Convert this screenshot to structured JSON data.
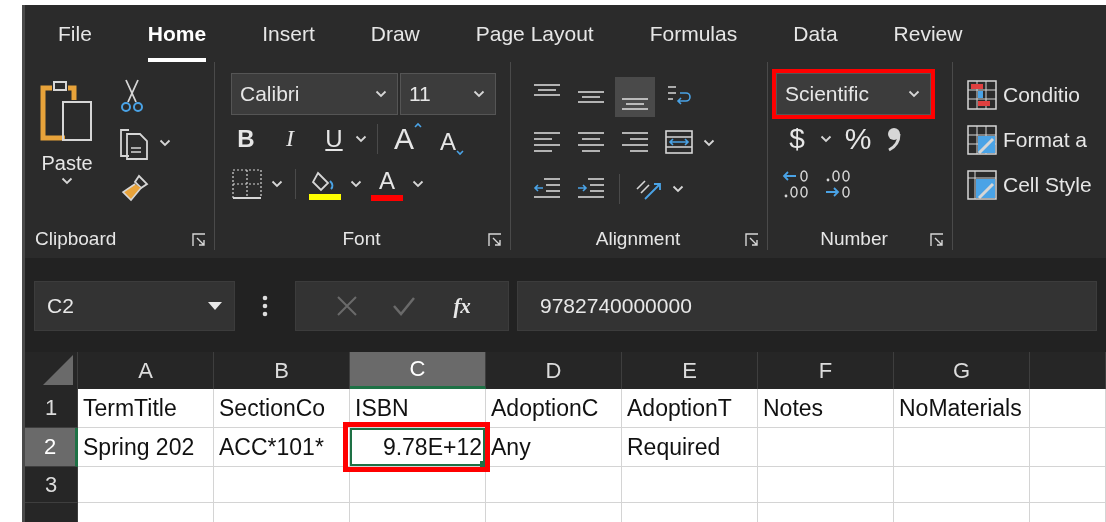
{
  "tabs": [
    {
      "label": "File",
      "selected": false
    },
    {
      "label": "Home",
      "selected": true
    },
    {
      "label": "Insert",
      "selected": false
    },
    {
      "label": "Draw",
      "selected": false
    },
    {
      "label": "Page Layout",
      "selected": false
    },
    {
      "label": "Formulas",
      "selected": false
    },
    {
      "label": "Data",
      "selected": false
    },
    {
      "label": "Review",
      "selected": false
    }
  ],
  "clipboard": {
    "paste_label": "Paste",
    "group_label": "Clipboard"
  },
  "font": {
    "name": "Calibri",
    "size": "11",
    "bold_label": "B",
    "italic_label": "I",
    "underline_label": "U",
    "grow_label": "A",
    "shrink_label": "A",
    "font_color_label": "A",
    "group_label": "Font"
  },
  "alignment": {
    "buttons": [
      {
        "kind": "top",
        "selected": false
      },
      {
        "kind": "middle",
        "selected": false
      },
      {
        "kind": "bottom",
        "selected": true
      },
      {
        "kind": "wrap",
        "selected": false
      },
      {
        "kind": "left",
        "selected": false
      },
      {
        "kind": "center",
        "selected": false
      },
      {
        "kind": "right",
        "selected": false
      },
      {
        "kind": "merge",
        "selected": false
      },
      {
        "kind": "outdent",
        "selected": false
      },
      {
        "kind": "indent",
        "selected": false
      },
      {
        "kind": "orientation",
        "selected": false
      }
    ],
    "group_label": "Alignment"
  },
  "number": {
    "format": "Scientific",
    "highlighted": true,
    "currency_label": "$",
    "percent_label": "%",
    "group_label": "Number"
  },
  "styles": {
    "items": [
      {
        "kind": "conditional",
        "label": "Conditio"
      },
      {
        "kind": "table",
        "label": "Format a"
      },
      {
        "kind": "cell",
        "label": "Cell Style"
      }
    ]
  },
  "formula_bar": {
    "name_box": "C2",
    "edit_buttons": [
      {
        "kind": "cancel",
        "disabled": true
      },
      {
        "kind": "enter",
        "disabled": true
      }
    ],
    "function_label": "fx",
    "formula": "9782740000000"
  },
  "sheet": {
    "columns": [
      {
        "label": "A",
        "selected": false
      },
      {
        "label": "B",
        "selected": false
      },
      {
        "label": "C",
        "selected": true
      },
      {
        "label": "D",
        "selected": false
      },
      {
        "label": "E",
        "selected": false
      },
      {
        "label": "F",
        "selected": false
      },
      {
        "label": "G",
        "selected": false
      }
    ],
    "rows": [
      {
        "header": "1",
        "selected": false,
        "cells": [
          {
            "text": "TermTitle"
          },
          {
            "text": "SectionCo"
          },
          {
            "text": "ISBN"
          },
          {
            "text": "AdoptionC"
          },
          {
            "text": "AdoptionT"
          },
          {
            "text": "Notes"
          },
          {
            "text": "NoMaterials"
          }
        ]
      },
      {
        "header": "2",
        "selected": true,
        "cells": [
          {
            "text": "Spring 202"
          },
          {
            "text": "ACC*101*"
          },
          {
            "text": "9.78E+12",
            "kind": "number",
            "active": true,
            "highlighted": true
          },
          {
            "text": "Any"
          },
          {
            "text": "Required"
          }
        ]
      },
      {
        "header": "3",
        "selected": false
      }
    ]
  }
}
